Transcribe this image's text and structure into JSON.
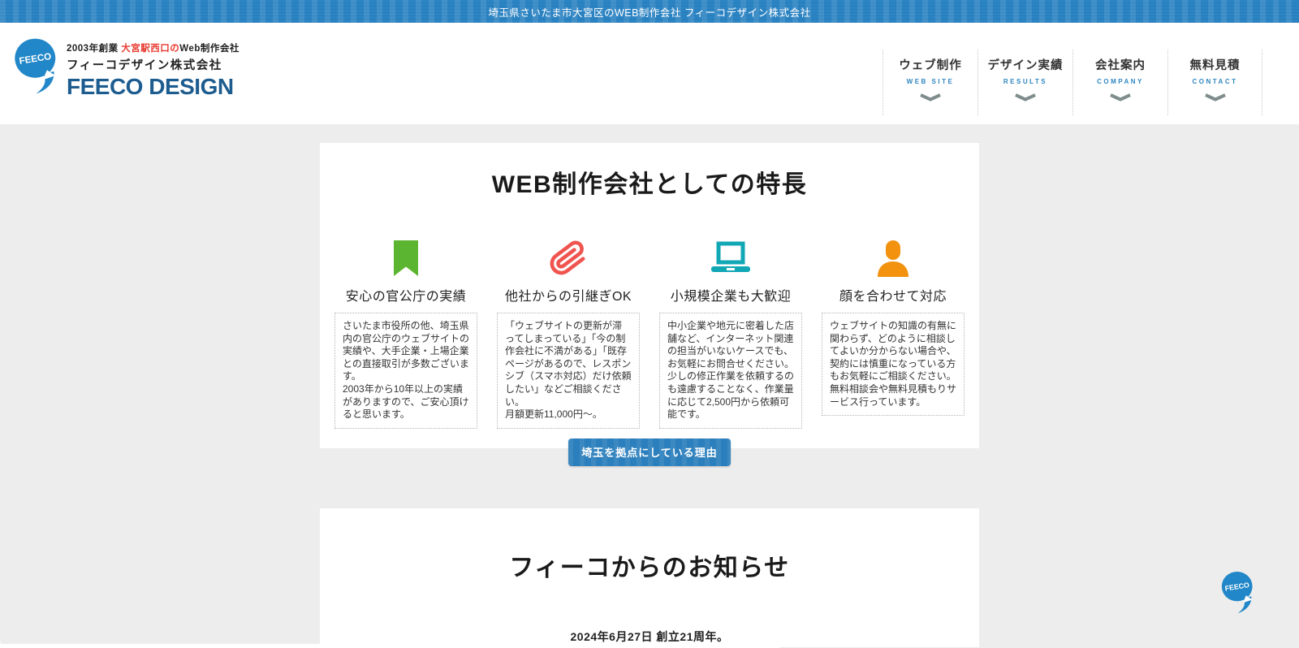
{
  "topbar": {
    "text": "埼玉県さいたま市大宮区のWEB制作会社 フィーコデザイン株式会社"
  },
  "logo": {
    "bubble_text": "FEECO",
    "tagline_prefix": "2003年創業 ",
    "tagline_highlight": "大宮駅西口の",
    "tagline_suffix": "Web制作会社",
    "company_name": "フィーコデザイン株式会社",
    "brand": "FEECO DESIGN"
  },
  "nav": {
    "items": [
      {
        "label": "ウェブ制作",
        "sublabel": "WEB SITE"
      },
      {
        "label": "デザイン実績",
        "sublabel": "RESULTS"
      },
      {
        "label": "会社案内",
        "sublabel": "COMPANY"
      },
      {
        "label": "無料見積",
        "sublabel": "CONTACT"
      }
    ]
  },
  "features": {
    "title": "WEB制作会社としての特長",
    "items": [
      {
        "icon": "bookmark-icon",
        "color": "#5cb531",
        "title": "安心の官公庁の実績",
        "body": "さいたま市役所の他、埼玉県内の官公庁のウェブサイトの実績や、大手企業・上場企業との直接取引が多数ございます。\n2003年から10年以上の実績がありますので、ご安心頂けると思います。"
      },
      {
        "icon": "paperclip-icon",
        "color": "#f0544f",
        "title": "他社からの引継ぎOK",
        "body": "「ウェブサイトの更新が滞ってしまっている」「今の制作会社に不満がある」「既存ページがあるので、レスポンシブ（スマホ対応）だけ依頼したい」などご相談ください。\n月額更新11,000円〜。"
      },
      {
        "icon": "laptop-icon",
        "color": "#12a7b5",
        "title": "小規模企業も大歓迎",
        "body": "中小企業や地元に密着した店舗など、インターネット関連の担当がいないケースでも、お気軽にお問合せください。少しの修正作業を依頼するのも遠慮することなく、作業量に応じて2,500円から依頼可能です。"
      },
      {
        "icon": "person-icon",
        "color": "#f2920f",
        "title": "顔を合わせて対応",
        "body": "ウェブサイトの知識の有無に関わらず、どのように相談してよいか分からない場合や、契約には慎重になっている方もお気軽にご相談ください。無料相談会や無料見積もりサービス行っています。"
      }
    ]
  },
  "cta_button": {
    "label": "埼玉を拠点にしている理由"
  },
  "news": {
    "title": "フィーコからのお知らせ",
    "entry": "2024年6月27日 創立21周年。"
  },
  "colors": {
    "topbar_blue": "#2b84c4",
    "brand_navy": "#1d5c8f",
    "bubble_blue": "#2187c8",
    "tagline_red": "#e8392f",
    "nav_sub_blue": "#2e86c1",
    "page_gray": "#ededed",
    "button_blue": "#2b7fbd"
  }
}
